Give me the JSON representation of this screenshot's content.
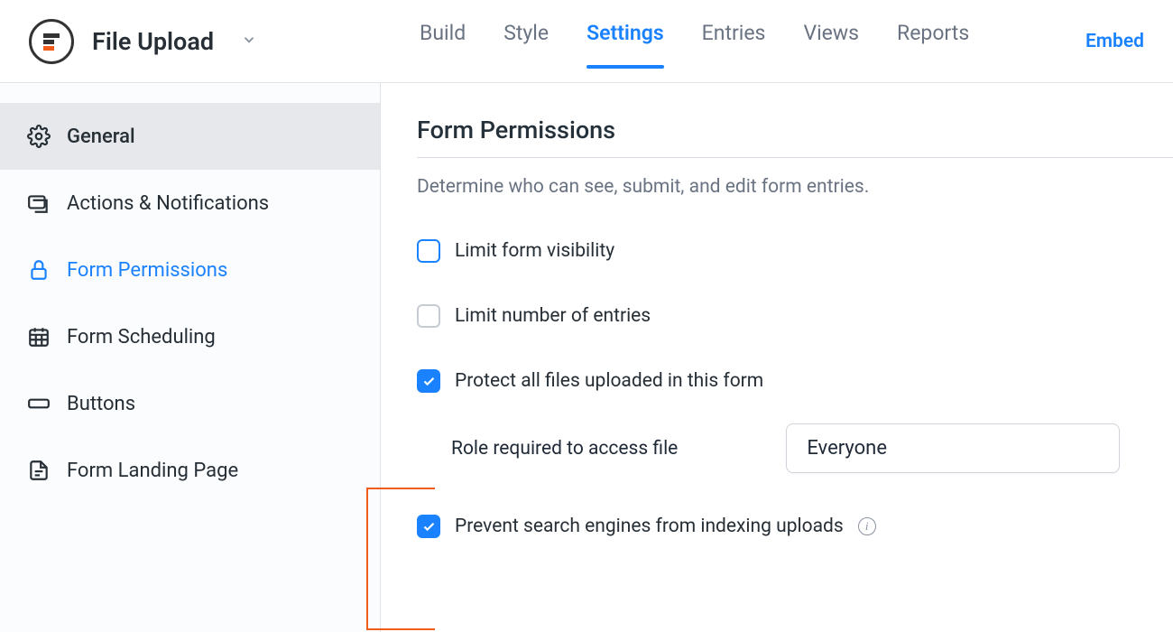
{
  "header": {
    "form_title": "File Upload",
    "tabs": [
      "Build",
      "Style",
      "Settings",
      "Entries",
      "Views",
      "Reports"
    ],
    "active_tab_index": 2,
    "embed_label": "Embed"
  },
  "sidebar": {
    "items": [
      {
        "label": "General",
        "icon": "gear-icon",
        "selected": true
      },
      {
        "label": "Actions & Notifications",
        "icon": "actions-icon"
      },
      {
        "label": "Form Permissions",
        "icon": "lock-icon",
        "current": true
      },
      {
        "label": "Form Scheduling",
        "icon": "calendar-icon"
      },
      {
        "label": "Buttons",
        "icon": "button-icon"
      },
      {
        "label": "Form Landing Page",
        "icon": "page-icon"
      }
    ]
  },
  "main": {
    "title": "Form Permissions",
    "subtitle": "Determine who can see, submit, and edit form entries.",
    "options": {
      "limit_visibility": {
        "label": "Limit form visibility",
        "checked": false,
        "style": "unchecked"
      },
      "limit_entries": {
        "label": "Limit number of entries",
        "checked": false,
        "style": "disabled"
      },
      "protect_files": {
        "label": "Protect all files uploaded in this form",
        "checked": true,
        "style": "checked"
      },
      "role_label": "Role required to access file",
      "role_value": "Everyone",
      "prevent_index": {
        "label": "Prevent search engines from indexing uploads",
        "checked": true,
        "style": "checked"
      }
    }
  }
}
